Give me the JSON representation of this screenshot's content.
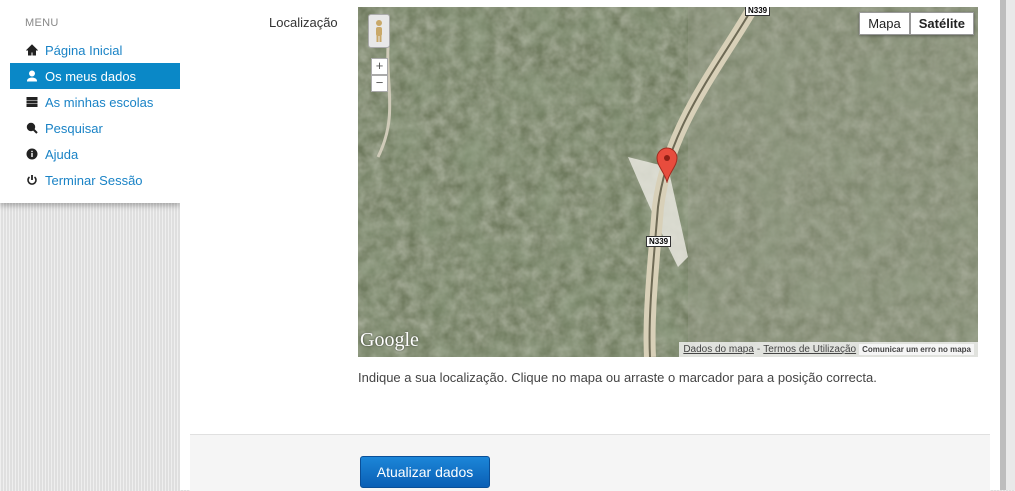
{
  "menu": {
    "title": "MENU",
    "items": [
      {
        "label": "Página Inicial",
        "icon": "home-icon"
      },
      {
        "label": "Os meus dados",
        "icon": "user-icon",
        "active": true
      },
      {
        "label": "As minhas escolas",
        "icon": "list-icon"
      },
      {
        "label": "Pesquisar",
        "icon": "search-icon"
      },
      {
        "label": "Ajuda",
        "icon": "info-icon"
      },
      {
        "label": "Terminar Sessão",
        "icon": "power-icon"
      }
    ]
  },
  "form": {
    "location_label": "Localização",
    "hint": "Indique a sua localização. Clique no mapa ou arraste o marcador para a posição correcta.",
    "submit_label": "Atualizar dados"
  },
  "map": {
    "type_buttons": [
      "Mapa",
      "Satélite"
    ],
    "selected_type": "Satélite",
    "zoom_in": "+",
    "zoom_out": "−",
    "road_labels": [
      "N339",
      "N339"
    ],
    "logo": "Google",
    "attribution": {
      "data_link": "Dados do mapa",
      "separator": "-",
      "terms_link": "Termos de Utilização",
      "report": "Comunicar um erro no mapa"
    }
  },
  "colors": {
    "accent": "#0a88c7",
    "link": "#1a83c6",
    "button": "#0a6fc8"
  }
}
